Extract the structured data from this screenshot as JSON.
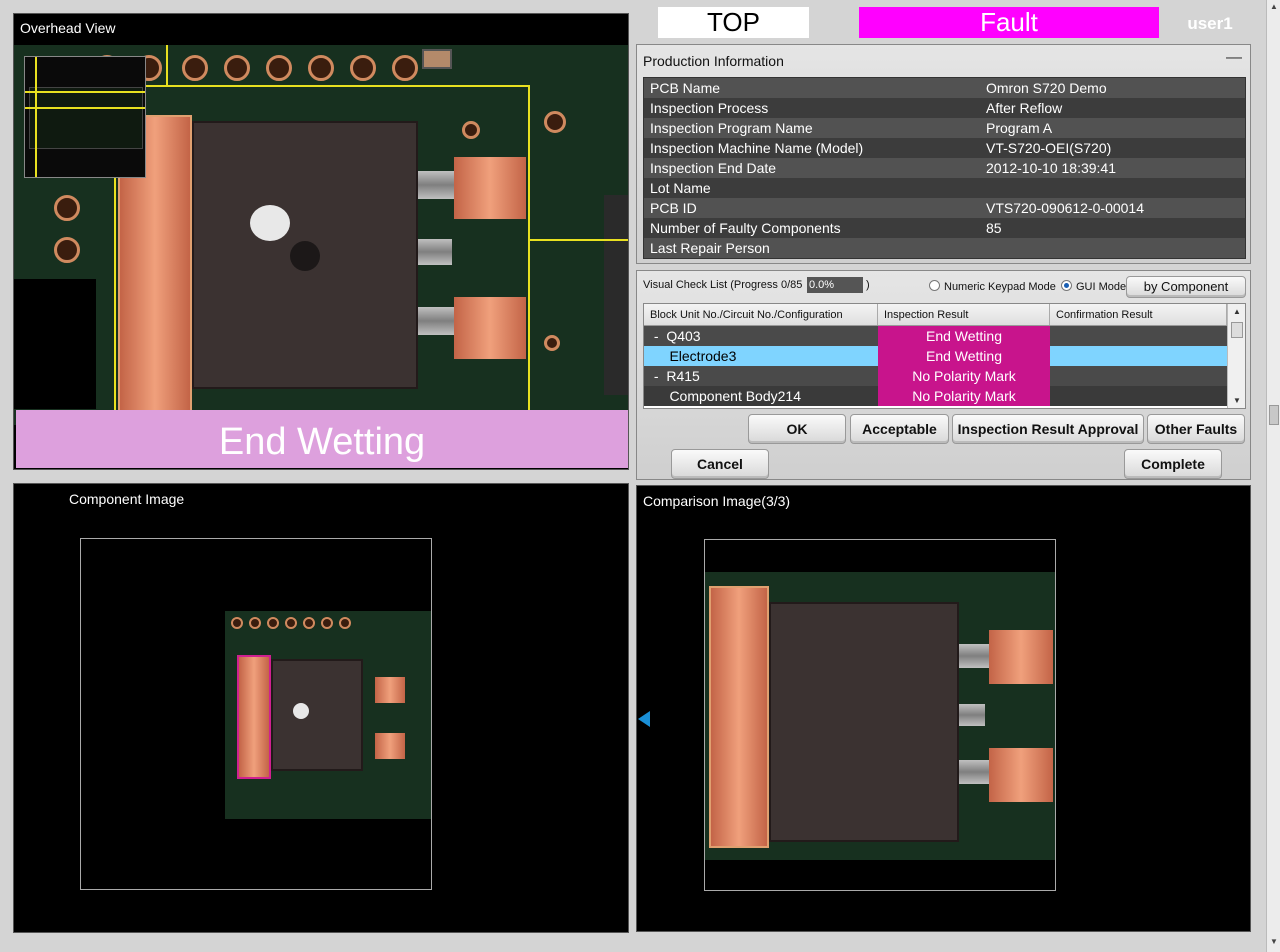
{
  "header": {
    "side_label": "TOP",
    "status_label": "Fault",
    "user": "user1",
    "colors": {
      "side_bg": "#ffffff",
      "status_bg": "#ff00ff"
    }
  },
  "overhead": {
    "title": "Overhead View",
    "fault_banner": "End Wetting",
    "colors": {
      "banner_bg": "#dda0dd",
      "roi": "#e8e020"
    }
  },
  "production_info": {
    "title": "Production Information",
    "collapse_icon": "minus-icon",
    "rows": [
      {
        "key": "PCB Name",
        "value": "Omron S720 Demo"
      },
      {
        "key": "Inspection Process",
        "value": "After Reflow"
      },
      {
        "key": "Inspection Program Name",
        "value": "Program A"
      },
      {
        "key": "Inspection Machine Name (Model)",
        "value": "VT-S720-OEI(S720)"
      },
      {
        "key": "Inspection End Date",
        "value": "2012-10-10 18:39:41"
      },
      {
        "key": "Lot Name",
        "value": ""
      },
      {
        "key": "PCB ID",
        "value": "VTS720-090612-0-00014"
      },
      {
        "key": "Number of Faulty Components",
        "value": "85"
      },
      {
        "key": "Last Repair Person",
        "value": ""
      }
    ]
  },
  "check_list": {
    "label": "Visual Check List (Progress 0/85",
    "progress": "0.0%",
    "label_close": ")",
    "modes": [
      {
        "label": "Numeric Keypad Mode",
        "selected": false
      },
      {
        "label": "GUI Mode",
        "selected": true
      }
    ],
    "group_button": "by Component",
    "columns": [
      "Block Unit No./Circuit No./Configuration",
      "Inspection Result",
      "Confirmation Result"
    ],
    "rows": [
      {
        "name": " -  Q403",
        "result": "End Wetting",
        "confirm": "",
        "selected": false
      },
      {
        "name": "     Electrode3",
        "result": "End Wetting",
        "confirm": "",
        "selected": true
      },
      {
        "name": " -  R415",
        "result": "No Polarity Mark",
        "confirm": "",
        "selected": false
      },
      {
        "name": "     Component Body214",
        "result": "No Polarity Mark",
        "confirm": "",
        "selected": false
      }
    ],
    "colors": {
      "result_bg": "#c8148c",
      "selected_bg": "#7fd4ff"
    }
  },
  "actions": {
    "ok": "OK",
    "acceptable": "Acceptable",
    "approval": "Inspection Result Approval",
    "other_faults": "Other Faults",
    "cancel": "Cancel",
    "complete": "Complete"
  },
  "component_image": {
    "title": "Component Image"
  },
  "comparison_image": {
    "title": "Comparison Image(3/3)",
    "nav_icon": "arrow-left-icon"
  }
}
